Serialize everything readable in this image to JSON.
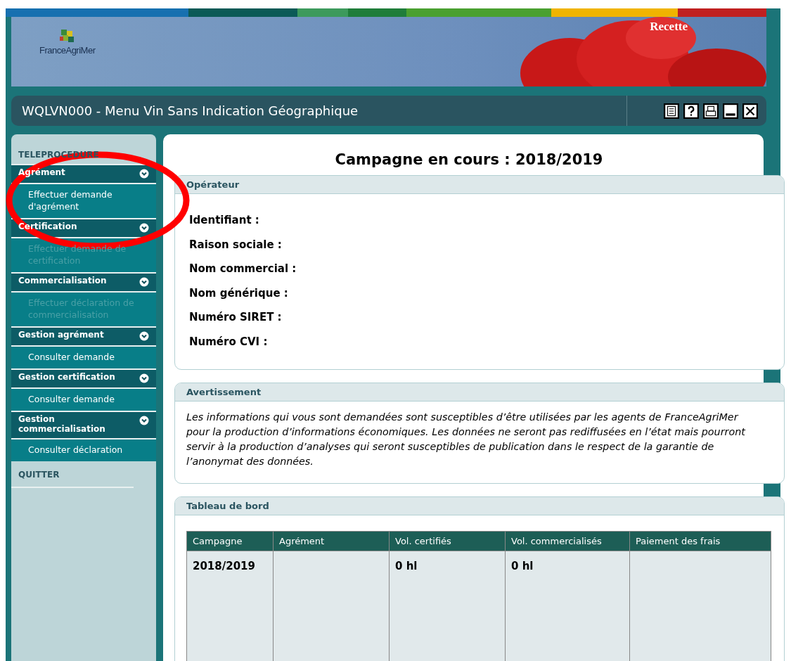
{
  "banner": {
    "logo_text": "FranceAgriMer",
    "environment": "Recette"
  },
  "title_bar": {
    "title": "WQLVN000 - Menu Vin Sans Indication Géographique"
  },
  "sidebar": {
    "heading": "TELEPROCEDURE",
    "groups": [
      {
        "label": "Agrément",
        "items": [
          {
            "label": "Effectuer demande d'agrément",
            "disabled": false
          }
        ]
      },
      {
        "label": "Certification",
        "items": [
          {
            "label": "Effectuer demande de certification",
            "disabled": true
          }
        ]
      },
      {
        "label": "Commercialisation",
        "items": [
          {
            "label": "Effectuer déclaration de commercialisation",
            "disabled": true
          }
        ]
      },
      {
        "label": "Gestion agrément",
        "items": [
          {
            "label": "Consulter demande",
            "disabled": false
          }
        ]
      },
      {
        "label": "Gestion certification",
        "items": [
          {
            "label": "Consulter demande",
            "disabled": false
          }
        ]
      },
      {
        "label": "Gestion commercialisation",
        "items": [
          {
            "label": "Consulter déclaration",
            "disabled": false
          }
        ]
      }
    ],
    "quit": "QUITTER"
  },
  "main": {
    "heading": "Campagne en cours : 2018/2019",
    "operator": {
      "title": "Opérateur",
      "fields": [
        "Identifiant :",
        "Raison sociale :",
        "Nom commercial :",
        "Nom générique :",
        "Numéro SIRET :",
        "Numéro CVI :"
      ]
    },
    "warning": {
      "title": "Avertissement",
      "text": "Les informations qui vous sont demandées sont susceptibles d’être utilisées par les agents de FranceAgriMer pour la production d’informations économiques. Les données ne seront pas rediffusées en l’état mais pourront servir à la production d’analyses qui seront susceptibles de publication dans le respect de la garantie de l’anonymat des données."
    },
    "dashboard": {
      "title": "Tableau de bord",
      "columns": [
        "Campagne",
        "Agrément",
        "Vol. certifiés",
        "Vol. commercialisés",
        "Paiement des frais"
      ],
      "rows": [
        [
          "2018/2019",
          "",
          "0 hl",
          "0 hl",
          ""
        ]
      ]
    }
  }
}
